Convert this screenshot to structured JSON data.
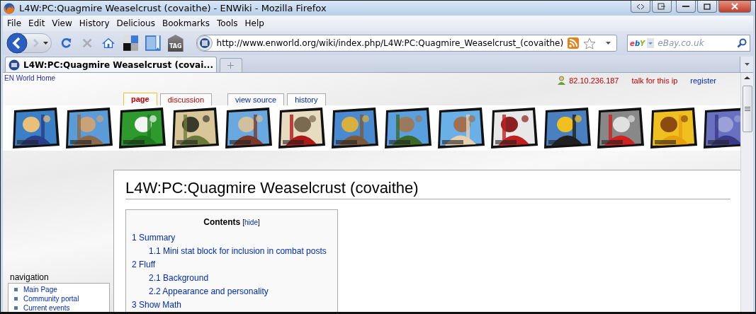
{
  "window": {
    "title": "L4W:PC:Quagmire Weaselcrust (covaithe) - ENWiki - Mozilla Firefox"
  },
  "menu": [
    "File",
    "Edit",
    "View",
    "History",
    "Delicious",
    "Bookmarks",
    "Tools",
    "Help"
  ],
  "toolbar": {
    "stop_disabled": true,
    "tag_label": "TAG",
    "url": "http://www.enworld.org/wiki/index.php/L4W:PC:Quagmire_Weaselcrust_(covaithe)",
    "search_engine": "ebY",
    "search_placeholder": "eBay.co.uk"
  },
  "tabs": [
    {
      "label": "L4W:PC:Quagmire Weaselcrust (covai...",
      "selected": true
    }
  ],
  "page": {
    "home_link": "EN World Home",
    "personal": [
      {
        "label": "82.10.236.187",
        "kind": "user"
      },
      {
        "label": "talk for this ip",
        "kind": "new"
      },
      {
        "label": "register",
        "kind": "link"
      }
    ],
    "page_tabs": [
      {
        "label": "page",
        "selected": true,
        "kind": "new"
      },
      {
        "label": "discussion",
        "selected": false,
        "kind": "new"
      },
      {
        "label": "view source",
        "selected": false,
        "kind": "link"
      },
      {
        "label": "history",
        "selected": false,
        "kind": "link"
      }
    ],
    "heading": "L4W:PC:Quagmire Weaselcrust (covaithe)",
    "toc": {
      "title": "Contents",
      "toggle": {
        "open": "[",
        "label": "hide",
        "close": "]"
      },
      "items": [
        {
          "label": "1 Summary",
          "children": [
            {
              "label": "1.1 Mini stat block for inclusion in combat posts"
            }
          ]
        },
        {
          "label": "2 Fluff",
          "children": [
            {
              "label": "2.1 Background"
            },
            {
              "label": "2.2 Appearance and personality"
            }
          ]
        },
        {
          "label": "3 Show Math"
        }
      ]
    },
    "sidebar": {
      "title": "navigation",
      "items": [
        "Main Page",
        "Community portal",
        "Current events"
      ]
    }
  }
}
